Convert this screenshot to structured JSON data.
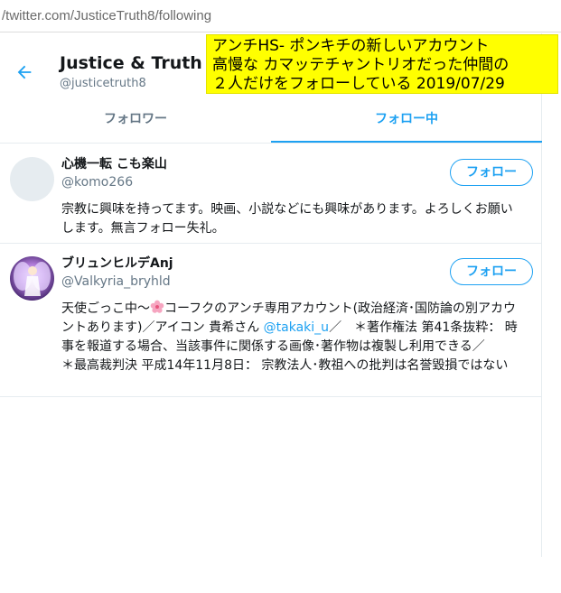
{
  "browser": {
    "url_prefix": "/twitter.com/",
    "url_path": "JusticeTruth8/following"
  },
  "profile": {
    "name": "Justice & Truth",
    "handle": "@justicetruth8",
    "back_icon": "arrow-left-icon"
  },
  "tabs": [
    {
      "label": "フォロワー",
      "active": false
    },
    {
      "label": "フォロー中",
      "active": true
    }
  ],
  "users": [
    {
      "name": "心機一転 こも楽山",
      "handle": "@komo266",
      "follow_label": "フォロー",
      "bio": "宗教に興味を持ってます。映画、小説などにも興味があります。よろしくお願いします。無言フォロー失礼。"
    },
    {
      "name": "ブリュンヒルデAnj",
      "handle": "@Valkyria_bryhld",
      "follow_label": "フォロー",
      "bio_part1": "天使ごっこ中～",
      "bio_part2": "コーフクのアンチ専用アカウント(政治経済･国防論の別アカウントあります)／アイコン 貴希さん ",
      "bio_mention": "@takaki_u",
      "bio_part3": "／　＊著作権法 第41条抜粋： 時事を報道する場合、当該事件に関係する画像･著作物は複製し利用できる／　　＊最高裁判決 平成14年11月8日： 宗教法人･教祖への批判は名誉毀損ではない"
    }
  ],
  "annotation": {
    "line1": "アンチHS- ポンキチの新しいアカウント",
    "line2": "高慢な カマッテチャントリオだった仲間の",
    "line3": "２人だけをフォローしている  2019/07/29"
  },
  "colors": {
    "accent": "#1da1f2",
    "secondary_text": "#657786",
    "annotation_bg": "#ffff00"
  }
}
